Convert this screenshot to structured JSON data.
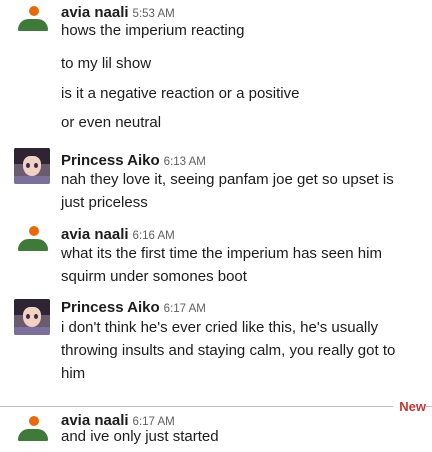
{
  "messages": [
    {
      "author": "avia naali",
      "time": "5:53 AM",
      "avatar": "person-icon",
      "lines": [
        "hows the imperium reacting",
        "to my lil show",
        "is it a negative reaction or a positive",
        "or even neutral"
      ]
    },
    {
      "author": "Princess Aiko",
      "time": "6:13 AM",
      "avatar": "anime-avatar",
      "lines": [
        "nah they love it, seeing panfam joe get so upset is",
        "just priceless"
      ]
    },
    {
      "author": "avia naali",
      "time": "6:16 AM",
      "avatar": "person-icon",
      "lines": [
        "what its the first time the imperium has seen him",
        "squirm under somones boot"
      ]
    },
    {
      "author": "Princess Aiko",
      "time": "6:17 AM",
      "avatar": "anime-avatar",
      "lines": [
        "i don't think he's ever cried like this, he's usually",
        "throwing insults and staying calm, you really got to",
        "him"
      ]
    },
    {
      "author": "avia naali",
      "time": "6:17 AM",
      "avatar": "person-icon",
      "lines": [
        "and ive only just started"
      ]
    }
  ],
  "divider": {
    "label": "New",
    "color": "#c13636"
  },
  "colors": {
    "person_head": "#e8690c",
    "person_body": "#3f7a3a",
    "text": "#1d1c1d",
    "timestamp": "#616061"
  }
}
